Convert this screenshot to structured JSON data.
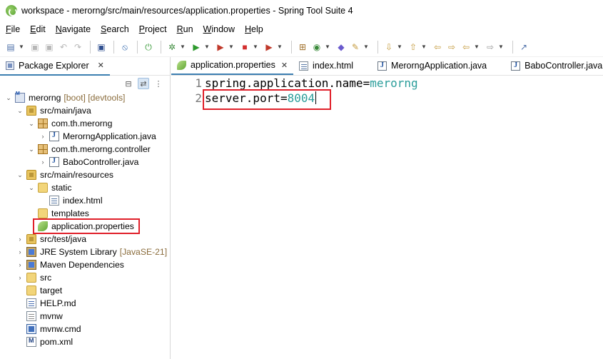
{
  "window": {
    "title": "workspace - merorng/src/main/resources/application.properties - Spring Tool Suite 4"
  },
  "menu": [
    {
      "mnemonic": "F",
      "rest": "ile"
    },
    {
      "mnemonic": "E",
      "rest": "dit"
    },
    {
      "mnemonic": "N",
      "rest": "avigate"
    },
    {
      "mnemonic": "S",
      "rest": "earch"
    },
    {
      "mnemonic": "P",
      "rest": "roject"
    },
    {
      "mnemonic": "R",
      "rest": "un"
    },
    {
      "mnemonic": "W",
      "rest": "indow"
    },
    {
      "mnemonic": "H",
      "rest": "elp"
    }
  ],
  "package_explorer": {
    "tab_label": "Package Explorer",
    "close_glyph": "✕",
    "tree": [
      {
        "label": "merorng",
        "decor": "[boot] [devtools]",
        "icon": "project",
        "state": "expanded"
      },
      {
        "label": "src/main/java",
        "icon": "srcfolder",
        "state": "expanded"
      },
      {
        "label": "com.th.merorng",
        "icon": "package",
        "state": "expanded"
      },
      {
        "label": "MerorngApplication.java",
        "icon": "java",
        "state": "collapsed"
      },
      {
        "label": "com.th.merorng.controller",
        "icon": "package",
        "state": "expanded"
      },
      {
        "label": "BaboController.java",
        "icon": "java",
        "state": "collapsed"
      },
      {
        "label": "src/main/resources",
        "icon": "srcfolder",
        "state": "expanded"
      },
      {
        "label": "static",
        "icon": "folder",
        "state": "expanded"
      },
      {
        "label": "index.html",
        "icon": "html",
        "state": "leaf"
      },
      {
        "label": "templates",
        "icon": "folder",
        "state": "leaf"
      },
      {
        "label": "application.properties",
        "icon": "properties",
        "state": "leaf"
      },
      {
        "label": "src/test/java",
        "icon": "srcfolder",
        "state": "collapsed"
      },
      {
        "label": "JRE System Library",
        "decor": "[JavaSE-21]",
        "icon": "library",
        "state": "collapsed"
      },
      {
        "label": "Maven Dependencies",
        "icon": "library",
        "state": "collapsed"
      },
      {
        "label": "src",
        "icon": "folder",
        "state": "collapsed"
      },
      {
        "label": "target",
        "icon": "folder",
        "state": "leaf"
      },
      {
        "label": "HELP.md",
        "icon": "md-file",
        "state": "leaf"
      },
      {
        "label": "mvnw",
        "icon": "file",
        "state": "leaf"
      },
      {
        "label": "mvnw.cmd",
        "icon": "cmd-file",
        "state": "leaf"
      },
      {
        "label": "pom.xml",
        "icon": "pom-file",
        "state": "leaf"
      }
    ]
  },
  "editor": {
    "tabs": [
      {
        "label": "application.properties",
        "icon": "properties",
        "active": true
      },
      {
        "label": "index.html",
        "icon": "html",
        "active": false
      },
      {
        "label": "MerorngApplication.java",
        "icon": "java",
        "active": false
      },
      {
        "label": "BaboController.java",
        "icon": "java",
        "active": false
      }
    ],
    "close_glyph": "✕",
    "lines": [
      {
        "number": "1",
        "key": "spring.application.name",
        "eq": "=",
        "value": "merorng"
      },
      {
        "number": "2",
        "key": "server.port",
        "eq": "=",
        "value": "8004"
      }
    ]
  },
  "colors": {
    "accent": "#3c7fb1",
    "highlight_box": "#e0202a",
    "property_value": "#2a9d9a"
  }
}
